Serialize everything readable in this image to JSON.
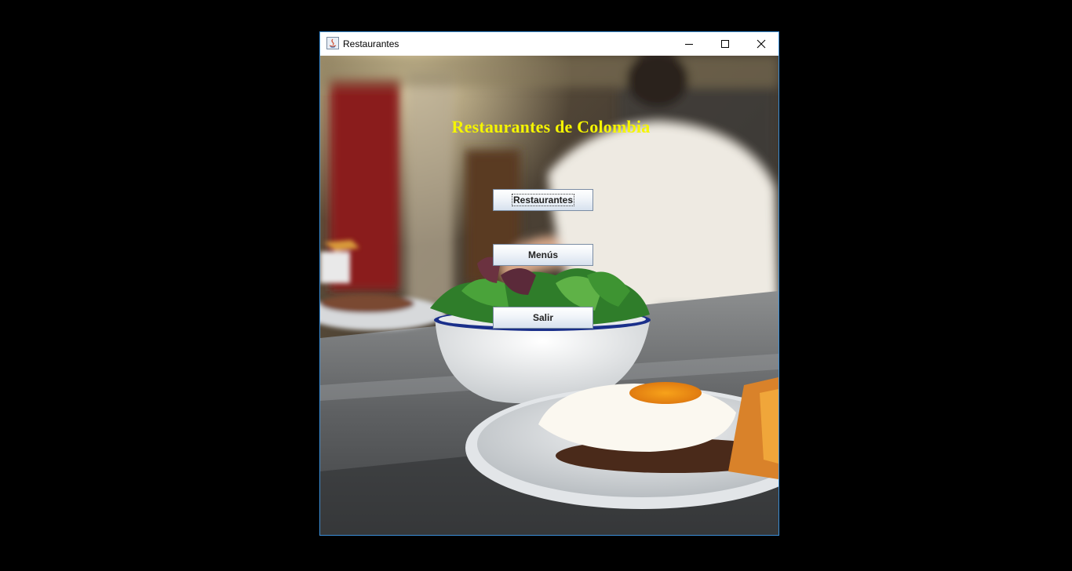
{
  "window": {
    "title": "Restaurantes",
    "controls": [
      "minimize-icon",
      "maximize-icon",
      "close-icon"
    ]
  },
  "main": {
    "heading": "Restaurantes de Colombia",
    "buttons": {
      "restaurantes": "Restaurantes",
      "menus": "Menús",
      "salir": "Salir"
    },
    "focused_button": "restaurantes"
  },
  "colors": {
    "heading": "#f5f500",
    "window_border": "#3c8fd8",
    "desktop": "#000000"
  }
}
